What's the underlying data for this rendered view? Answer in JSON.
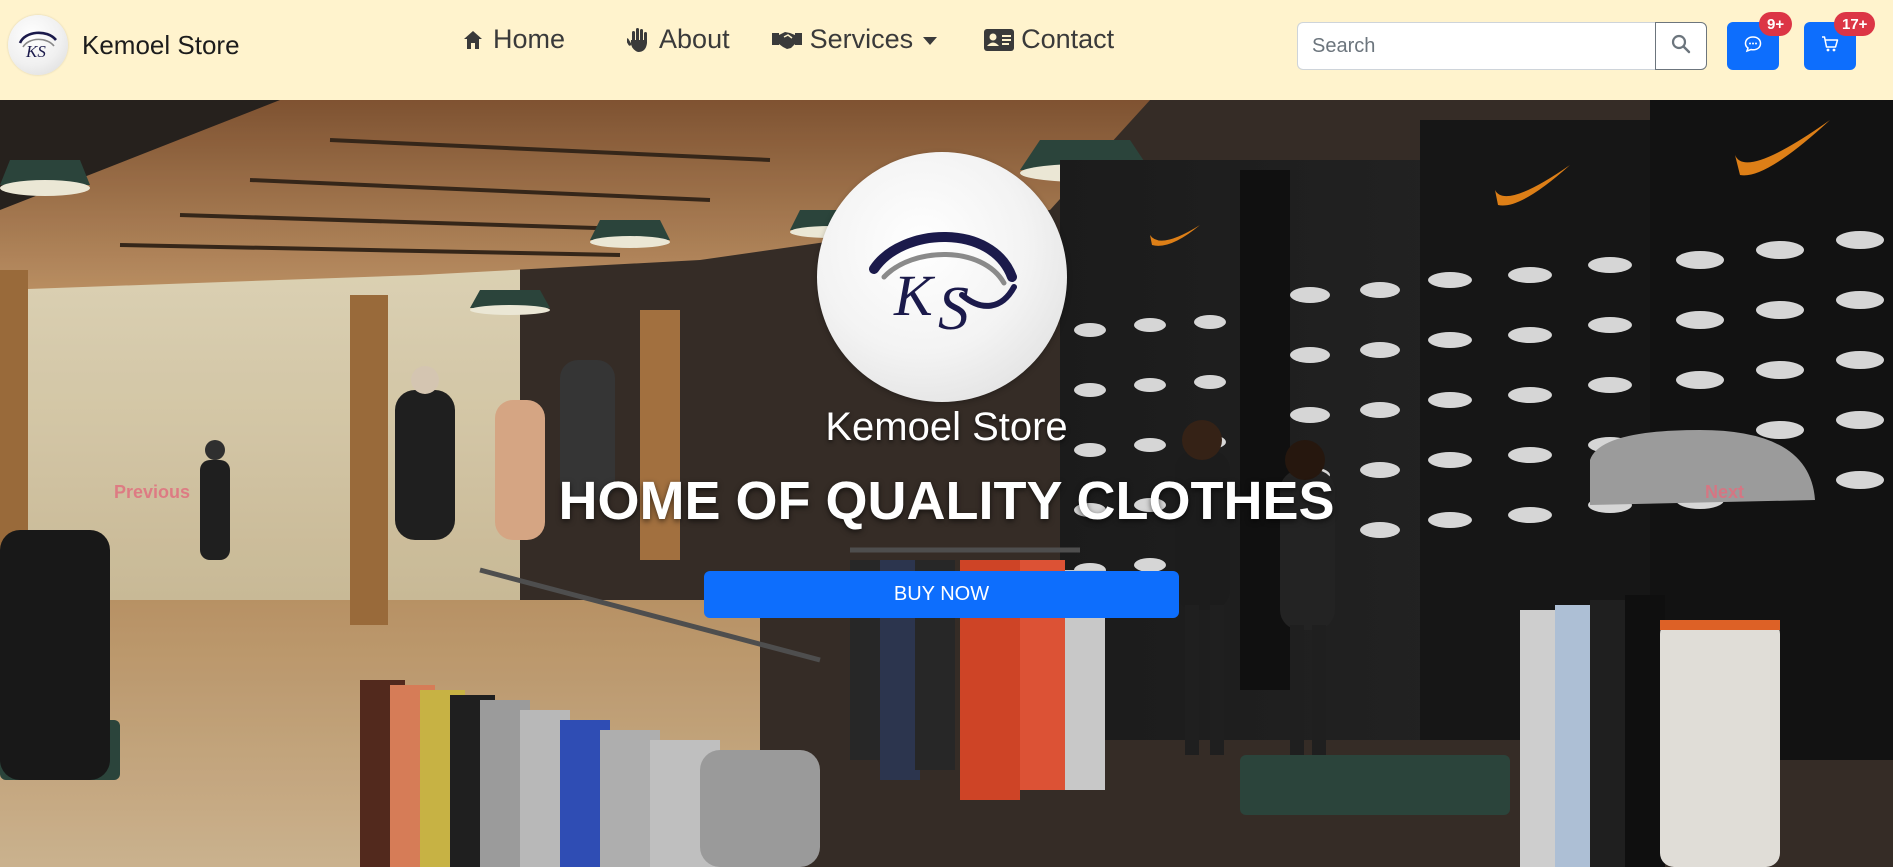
{
  "brand": {
    "name": "Kemoel Store",
    "logo_text": "KS"
  },
  "nav": {
    "home": "Home",
    "about": "About",
    "services": "Services",
    "contact": "Contact"
  },
  "search": {
    "placeholder": "Search"
  },
  "badges": {
    "messages": "9+",
    "cart": "17+"
  },
  "hero": {
    "subtitle": "Kemoel Store",
    "title": "HOME OF QUALITY CLOTHES",
    "cta": "BUY NOW",
    "prev": "Previous",
    "next": "Next"
  },
  "colors": {
    "navbar_bg": "#fff3cd",
    "primary": "#0d6efd",
    "badge": "#dc3545",
    "logo_navy": "#1b1a4b"
  },
  "icons": [
    "house-icon",
    "hand-icon",
    "handshake-icon",
    "id-card-icon",
    "search-icon",
    "chat-icon",
    "cart-icon"
  ]
}
